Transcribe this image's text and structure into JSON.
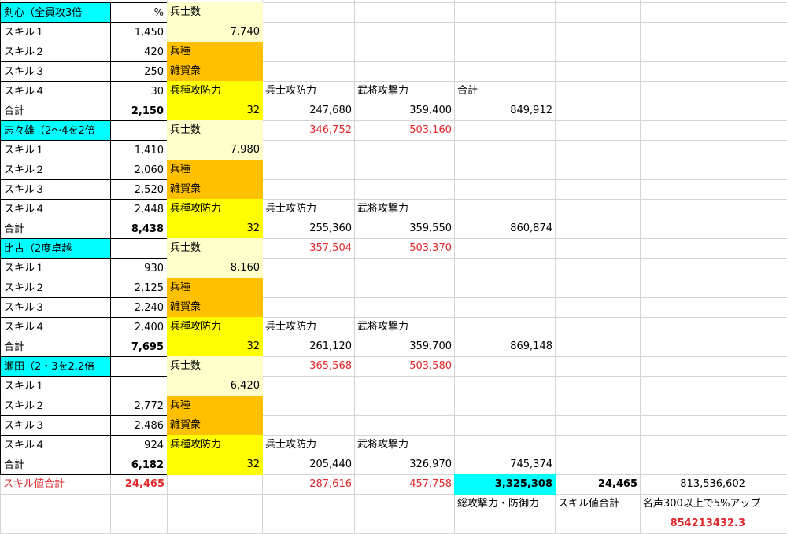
{
  "units": [
    {
      "title": "剣心（全員攻3倍",
      "percent_label": "%",
      "skills": [
        {
          "label": "スキル１",
          "value": "1,450"
        },
        {
          "label": "スキル２",
          "value": "420"
        },
        {
          "label": "スキル３",
          "value": "250"
        },
        {
          "label": "スキル４",
          "value": "30"
        }
      ],
      "total_label": "合計",
      "total": "2,150",
      "troops_label": "兵士数",
      "troops": "7,740",
      "type_label": "兵種",
      "type_value": "雑賀衆",
      "attack_label": "兵種攻防力",
      "attack_value": "32",
      "upper_vals": [
        "346,752",
        "503,160"
      ],
      "header_labels": [
        "兵士攻防力",
        "武将攻撃力",
        "合計"
      ],
      "bottom_vals": [
        "247,680",
        "359,400",
        "849,912"
      ]
    },
    {
      "title": "志々雄（2〜4を2倍",
      "percent_label": "",
      "skills": [
        {
          "label": "スキル１",
          "value": "1,410"
        },
        {
          "label": "スキル２",
          "value": "2,060"
        },
        {
          "label": "スキル３",
          "value": "2,520"
        },
        {
          "label": "スキル４",
          "value": "2,448"
        }
      ],
      "total_label": "合計",
      "total": "8,438",
      "troops_label": "兵士数",
      "troops": "7,980",
      "type_label": "兵種",
      "type_value": "雑賀衆",
      "attack_label": "兵種攻防力",
      "attack_value": "32",
      "upper_vals": [
        "357,504",
        "503,370"
      ],
      "header_labels": [
        "兵士攻防力",
        "武将攻撃力",
        ""
      ],
      "bottom_vals": [
        "255,360",
        "359,550",
        "860,874"
      ]
    },
    {
      "title": "比古（2度卓越",
      "percent_label": "",
      "skills": [
        {
          "label": "スキル１",
          "value": "930"
        },
        {
          "label": "スキル２",
          "value": "2,125"
        },
        {
          "label": "スキル３",
          "value": "2,240"
        },
        {
          "label": "スキル４",
          "value": "2,400"
        }
      ],
      "total_label": "合計",
      "total": "7,695",
      "troops_label": "兵士数",
      "troops": "8,160",
      "type_label": "兵種",
      "type_value": "雑賀衆",
      "attack_label": "兵種攻防力",
      "attack_value": "32",
      "upper_vals": [
        "365,568",
        "503,580"
      ],
      "header_labels": [
        "兵士攻防力",
        "武将攻撃力",
        ""
      ],
      "bottom_vals": [
        "261,120",
        "359,700",
        "869,148"
      ]
    },
    {
      "title": "瀬田（2・3を2.2倍",
      "percent_label": "",
      "skills": [
        {
          "label": "スキル１",
          "value": ""
        },
        {
          "label": "スキル２",
          "value": "2,772"
        },
        {
          "label": "スキル３",
          "value": "2,486"
        },
        {
          "label": "スキル４",
          "value": "924"
        }
      ],
      "total_label": "合計",
      "total": "6,182",
      "troops_label": "兵士数",
      "troops": "6,420",
      "type_label": "兵種",
      "type_value": "雑賀衆",
      "attack_label": "兵種攻防力",
      "attack_value": "32",
      "upper_vals": [
        "287,616",
        "457,758"
      ],
      "header_labels": [
        "兵士攻防力",
        "武将攻撃力",
        ""
      ],
      "bottom_vals": [
        "205,440",
        "326,970",
        "745,374"
      ]
    }
  ],
  "summary": {
    "label": "スキル値合計",
    "skill_total": "24,465",
    "grand_total": "3,325,308",
    "skill_total_2": "24,465",
    "fame_value": "813,536,602",
    "grand_total_label": "総攻撃力・防御力",
    "skill_total_label": "スキル値合計",
    "fame_label": "名声300以上で5%アップ",
    "final_value": "854213432.3"
  },
  "colors": {
    "cyan": "#00ffff",
    "yellow": "#ffff00",
    "orange": "#ffc000",
    "pale_yellow": "#ffffcc",
    "red": "#e0282c"
  }
}
